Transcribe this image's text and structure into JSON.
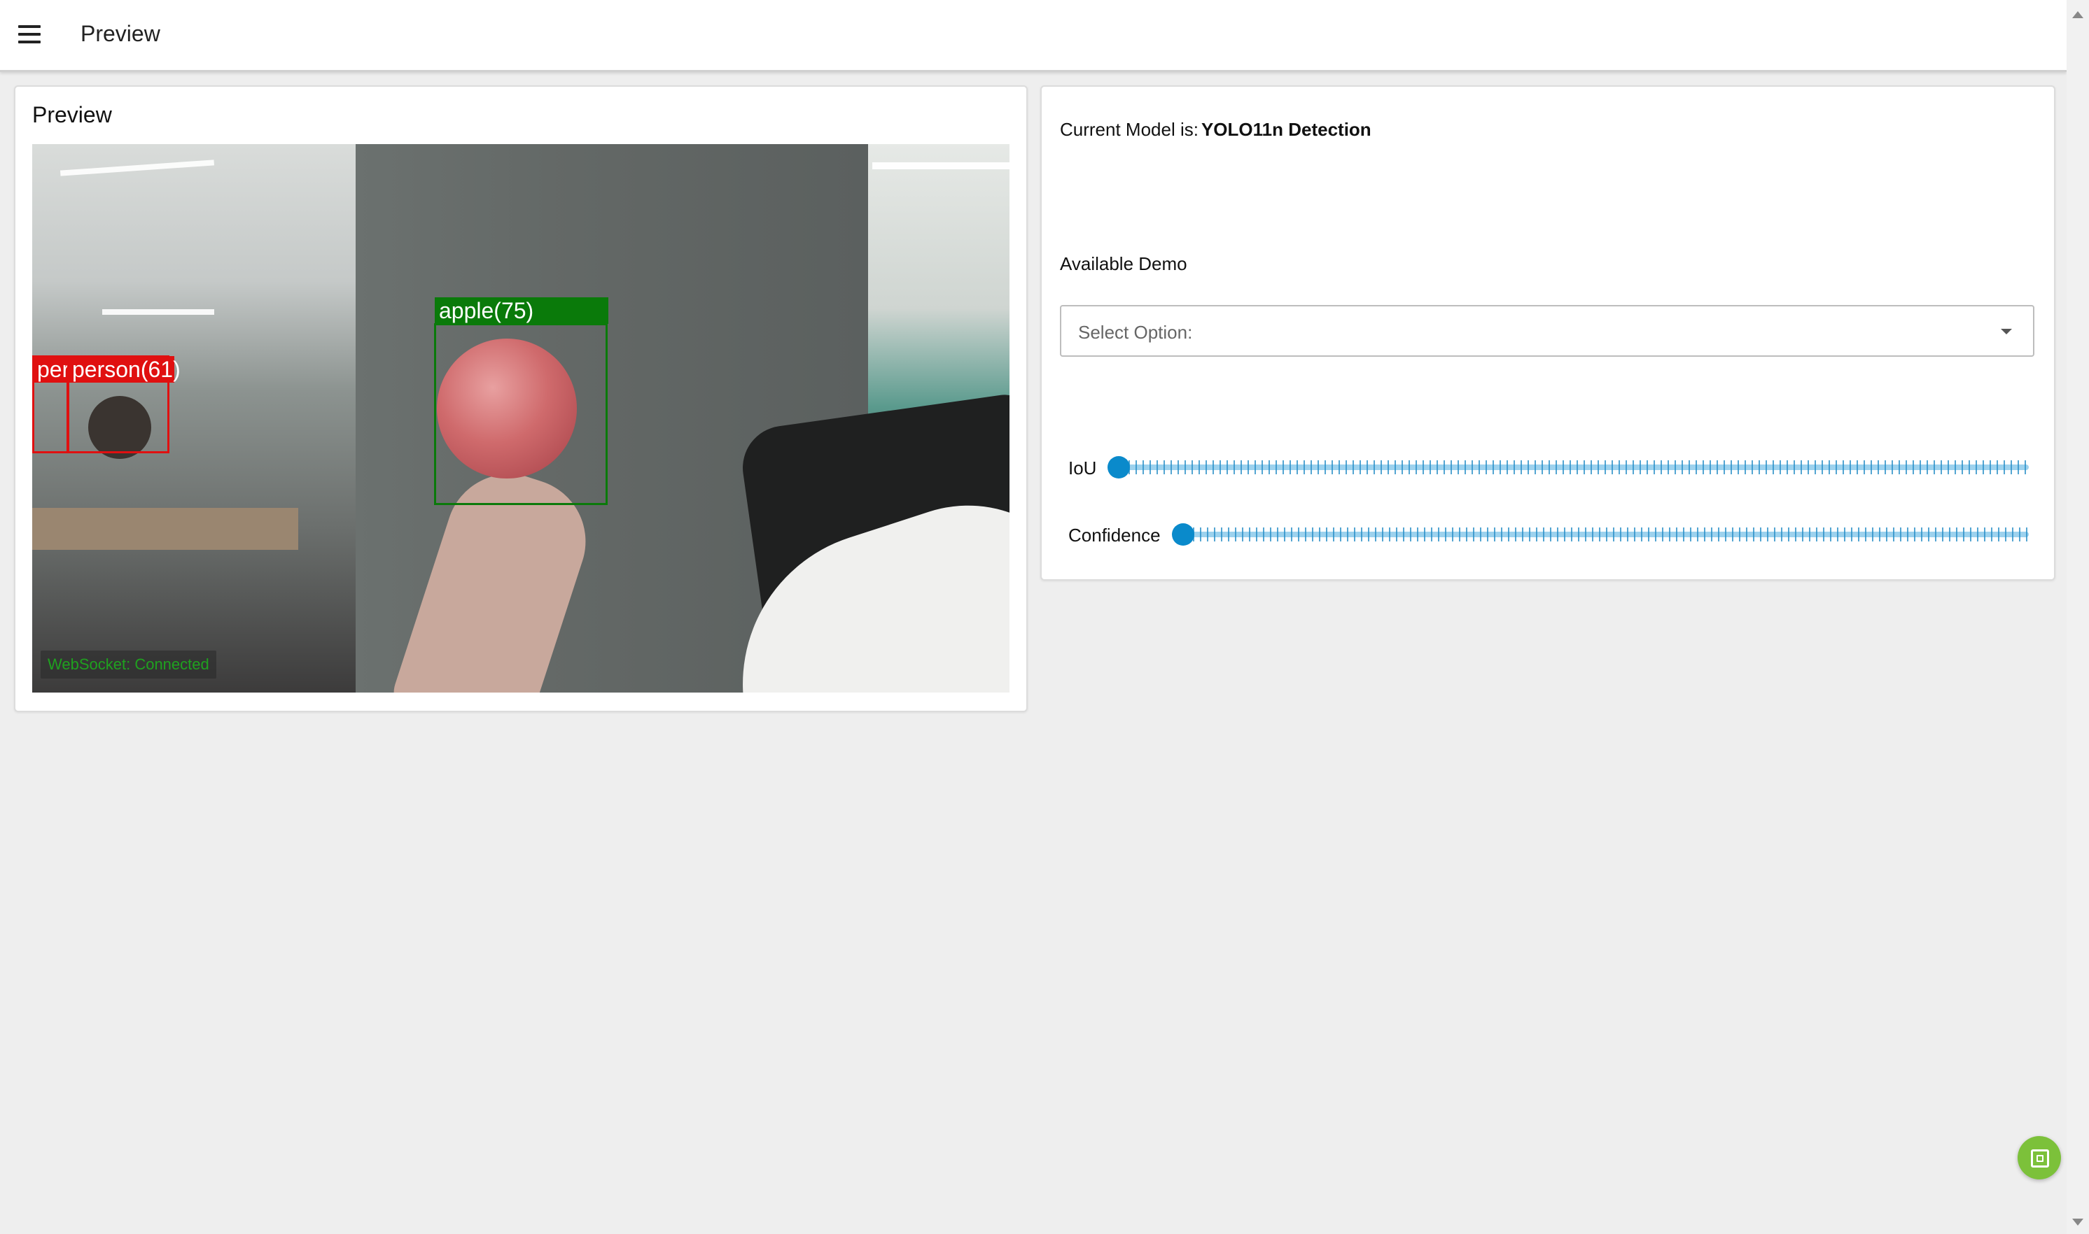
{
  "appbar": {
    "title": "Preview",
    "menu_icon": "hamburger-menu-icon"
  },
  "preview": {
    "title": "Preview",
    "detections": [
      {
        "label": "apple(75)",
        "color": "#0a7a0a"
      },
      {
        "label": "person(61)",
        "color": "#e01010"
      },
      {
        "label": "per",
        "color": "#e01010"
      }
    ],
    "websocket_status": "WebSocket: Connected"
  },
  "settings": {
    "model_prefix": "Current Model is:",
    "model_name": "YOLO11n Detection",
    "demo_label": "Available Demo",
    "select_placeholder": "Select Option:",
    "sliders": [
      {
        "label": "IoU",
        "value": 0.0
      },
      {
        "label": "Confidence",
        "value": 0.0
      }
    ],
    "accent_color": "#0a8acb"
  },
  "fab": {
    "icon": "code-window-icon",
    "color": "#7cc13a"
  }
}
